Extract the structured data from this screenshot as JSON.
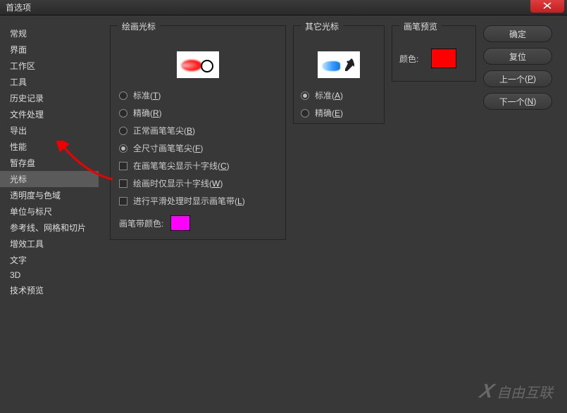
{
  "window": {
    "title": "首选项"
  },
  "sidebar": {
    "items": [
      "常规",
      "界面",
      "工作区",
      "工具",
      "历史记录",
      "文件处理",
      "导出",
      "性能",
      "暂存盘",
      "光标",
      "透明度与色域",
      "单位与标尺",
      "参考线、网格和切片",
      "增效工具",
      "文字",
      "3D",
      "技术预览"
    ],
    "selected_index": 9
  },
  "painting": {
    "title": "绘画光标",
    "radios": [
      {
        "label": "标准",
        "accel": "T",
        "checked": false
      },
      {
        "label": "精确",
        "accel": "R",
        "checked": false
      },
      {
        "label": "正常画笔笔尖",
        "accel": "B",
        "checked": false
      },
      {
        "label": "全尺寸画笔笔尖",
        "accel": "F",
        "checked": true
      }
    ],
    "checks": [
      {
        "label": "在画笔笔尖显示十字线",
        "accel": "C",
        "checked": false
      },
      {
        "label": "绘画时仅显示十字线",
        "accel": "W",
        "checked": false
      },
      {
        "label": "进行平滑处理时显示画笔带",
        "accel": "L",
        "checked": false
      }
    ],
    "brush_leash_color_label": "画笔带颜色:",
    "brush_leash_color": "#ff00ff"
  },
  "other": {
    "title": "其它光标",
    "radios": [
      {
        "label": "标准",
        "accel": "A",
        "checked": true
      },
      {
        "label": "精确",
        "accel": "E",
        "checked": false
      }
    ]
  },
  "preview": {
    "title": "画笔预览",
    "color_label": "颜色:",
    "color": "#ff0000"
  },
  "buttons": {
    "ok": "确定",
    "cancel": "复位",
    "prev": "上一个",
    "prev_accel": "P",
    "next": "下一个",
    "next_accel": "N"
  },
  "watermark": "自由互联"
}
